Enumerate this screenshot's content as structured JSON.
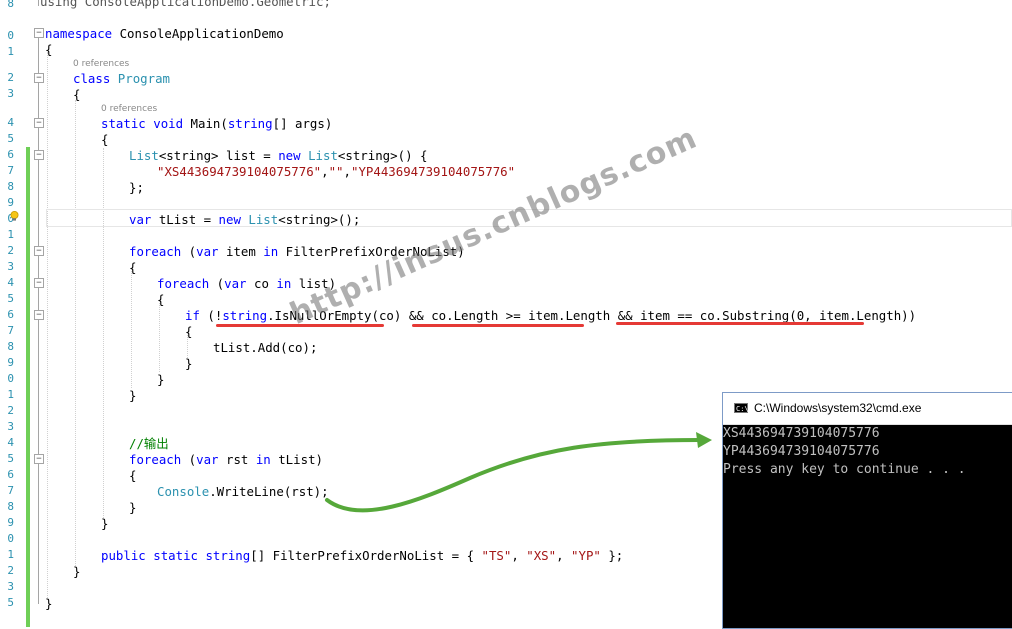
{
  "colors": {
    "keyword": "#0000ff",
    "type": "#2b91af",
    "string": "#a31515",
    "comment": "#008000",
    "underline": "#e53935",
    "arrow": "#56a83a",
    "change_bar": "#6fcf57"
  },
  "line_numbers": [
    "8",
    "",
    "0",
    "1",
    "2",
    "3",
    "",
    "4",
    "5",
    "6",
    "7",
    "8",
    "9",
    "0",
    "1",
    "2",
    "3",
    "4",
    "5",
    "6",
    "7",
    "8",
    "9",
    "0",
    "1",
    "2",
    "3",
    "4",
    "5",
    "6",
    "7",
    "8",
    "9",
    "0",
    "1",
    "2",
    "3"
  ],
  "code": {
    "using": "using ConsoleApplicationDemo.Geometric;",
    "ns_kw": "namespace",
    "ns_name": " ConsoleApplicationDemo",
    "brace_open": "{",
    "brace_close": "}",
    "lens_refs": "0 references",
    "class_kw": "class",
    "class_name": "Program",
    "static": "static",
    "void": "void",
    "main_sig": " Main(",
    "string": "string",
    "args": "[] args)",
    "list": "List",
    "lt_string_gt": "<string>",
    "list_decl": " list = ",
    "new": "new",
    "paren_brace": "() {",
    "s1": "\"XS443694739104075776\"",
    "comma1": ",",
    "s2": "\"\"",
    "comma2": ",",
    "s3": "\"YP443694739104075776\"",
    "close_init": "};",
    "var": "var",
    "tlist_decl": " tList = ",
    "paren_semi": "();",
    "foreach": "foreach",
    "open_paren": " (",
    "item": " item ",
    "in": "in",
    "filter_ref": " FilterPrefixOrderNoList)",
    "co": " co ",
    "list_ref": " list)",
    "if": "if",
    "if_open": " (!",
    "is_null": ".IsNullOrEmpty(co) && co.Length >= item.Length && item == co.Substring(0, item.Length))",
    "add": "tList.Add(co);",
    "comment": "//输出",
    "rst": " rst ",
    "tlist_ref": " tList)",
    "console": "Console",
    "writeline": ".WriteLine(rst);",
    "public": "public",
    "filter_decl_start": " FilterPrefixOrderNoList = { ",
    "ts": "\"TS\"",
    "sep": ", ",
    "xs": "\"XS\"",
    "yp": "\"YP\"",
    "filter_decl_end": " };",
    "arr": "[]"
  },
  "watermark": "http://insus.cnblogs.com",
  "console_window": {
    "title": "C:\\Windows\\system32\\cmd.exe",
    "icon_label": "C:\\",
    "lines": [
      "XS443694739104075776",
      "YP443694739104075776",
      "Press any key to continue . . ."
    ]
  }
}
